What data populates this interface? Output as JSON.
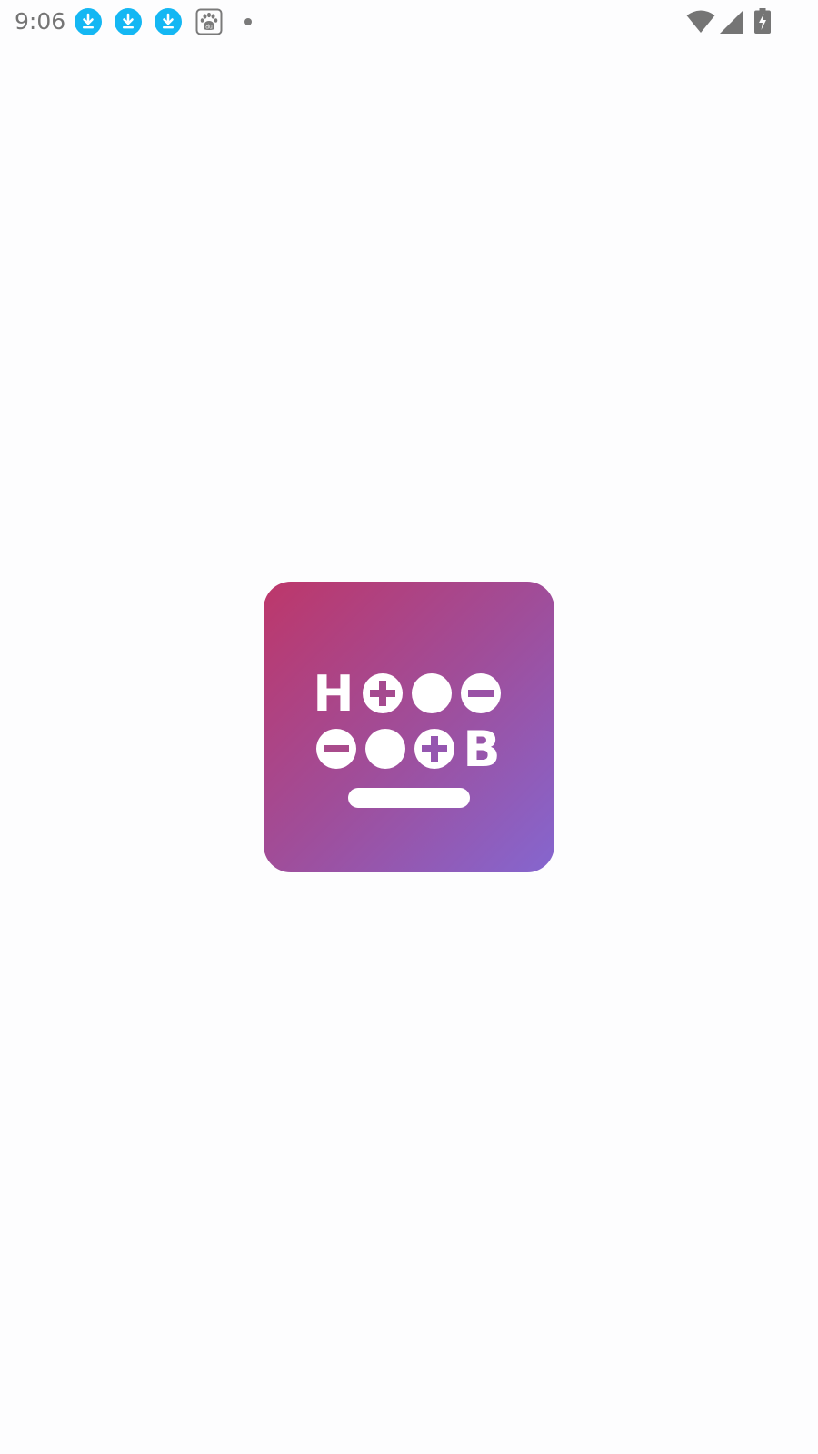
{
  "status_bar": {
    "time": "9:06",
    "notification_icons": [
      "download-icon",
      "download-icon",
      "download-icon",
      "baidu-paw-icon",
      "more-dot-icon"
    ],
    "system_icons": [
      "wifi-icon",
      "cellular-signal-icon",
      "battery-charging-icon"
    ],
    "download_color": "#14b7f3",
    "icon_gray": "#757575"
  },
  "splash": {
    "logo_icon": "app-logo-icon",
    "logo_letters": {
      "left": "H",
      "right": "B"
    },
    "gradient": {
      "start": "#bd376a",
      "middle": "#a04d99",
      "end": "#8566cf"
    }
  }
}
